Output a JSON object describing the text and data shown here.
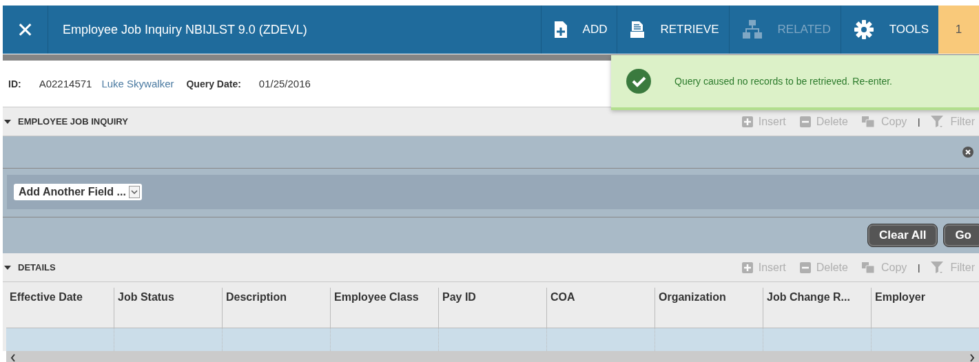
{
  "header": {
    "close": "✕",
    "title": "Employee Job Inquiry NBIJLST 9.0 (ZDEVL)",
    "actions": [
      {
        "kind": "add",
        "label": "ADD",
        "disabled": false
      },
      {
        "kind": "retrieve",
        "label": "RETRIEVE",
        "disabled": false
      },
      {
        "kind": "related",
        "label": "RELATED",
        "disabled": true
      },
      {
        "kind": "tools",
        "label": "TOOLS",
        "disabled": false
      }
    ],
    "badge": "1"
  },
  "key_block": {
    "id_label": "ID:",
    "id": "A02214571",
    "name": "Luke Skywalker",
    "date_label": "Query Date:",
    "date": "01/25/2016"
  },
  "notification": {
    "kind": "success",
    "message": "Query caused no records to be retrieved. Re-enter."
  },
  "inquiry_section": {
    "title": "EMPLOYEE JOB INQUIRY",
    "expanded": true,
    "tools": [
      {
        "kind": "insert",
        "label": "Insert",
        "disabled": true
      },
      {
        "kind": "delete",
        "label": "Delete",
        "disabled": true
      },
      {
        "kind": "copy",
        "label": "Copy",
        "disabled": true
      },
      {
        "kind": "separator",
        "label": "|"
      },
      {
        "kind": "filter",
        "label": "Filter",
        "disabled": true
      }
    ],
    "add_field": "Add Another Field ...",
    "buttons": [
      "Clear All",
      "Go"
    ]
  },
  "details_section": {
    "title": "DETAILS",
    "expanded": true,
    "tools": [
      {
        "kind": "insert",
        "label": "Insert",
        "disabled": true
      },
      {
        "kind": "delete",
        "label": "Delete",
        "disabled": true
      },
      {
        "kind": "copy",
        "label": "Copy",
        "disabled": true
      },
      {
        "kind": "separator",
        "label": "|"
      },
      {
        "kind": "filter",
        "label": "Filter",
        "disabled": true
      }
    ],
    "columns": [
      "Effective Date",
      "Job Status",
      "Description",
      "Employee Class",
      "Pay ID",
      "COA",
      "Organization",
      "Job Change R...",
      "Employer"
    ]
  }
}
